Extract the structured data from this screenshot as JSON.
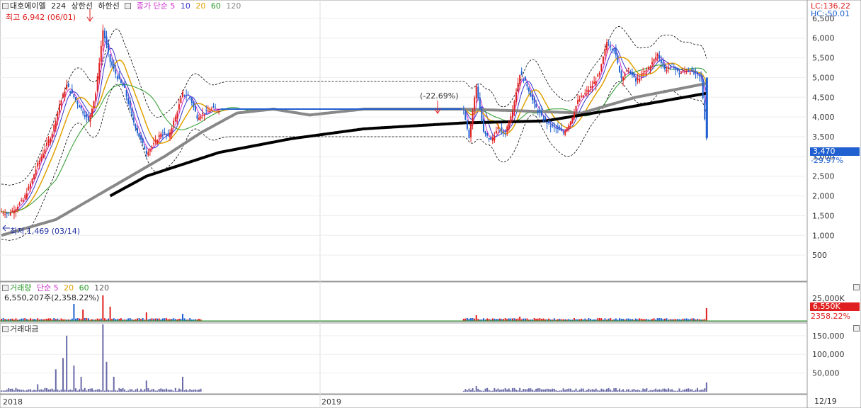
{
  "header": {
    "stock": "대호에이엘",
    "code": "224",
    "upper_band": "상한선",
    "lower_band": "하한선",
    "ma_label": "종가 단순 5",
    "ma10": "10",
    "ma20": "20",
    "ma60": "60",
    "ma120": "120"
  },
  "right_info": {
    "lc": "LC:136.22",
    "hc": "HC:-50.01",
    "current_price": "3,470",
    "change_pct": "-29.97%",
    "volume_badge": "6,550K",
    "volume_ratio": "2358.22%",
    "last_date": "12/19"
  },
  "annotations": {
    "high": "최고 6,942 (06/01)",
    "low": "최저 1,469 (03/14)",
    "drop": "(-22.69%)"
  },
  "volume_panel": {
    "title": "거래량",
    "ma_label": "단순 5",
    "ma20": "20",
    "ma60": "60",
    "ma120": "120",
    "current": "6,550,207주(2,358.22%)"
  },
  "amount_panel": {
    "title": "거래대금"
  },
  "colors": {
    "up": "#e02020",
    "down": "#2060d0",
    "ma5": "#cc33cc",
    "ma10": "#3333cc",
    "ma20": "#e0a000",
    "ma60": "#2a9a2a",
    "ma120": "#888888",
    "long_ma": "#000000",
    "amount": "#6a6aa8",
    "badge_price": "#2060d0",
    "badge_volume": "#e02020"
  },
  "chart_data": {
    "type": "candlestick",
    "x_labels": [
      "2018",
      "2019"
    ],
    "price_axis_ticks": [
      500,
      1000,
      1500,
      2000,
      2500,
      3000,
      3500,
      4000,
      4500,
      5000,
      5500,
      6000,
      6500
    ],
    "price_ylim": [
      0,
      7000
    ],
    "volume_axis_ticks": [
      "25,000K"
    ],
    "amount_axis_ticks": [
      "50,000",
      "100,000",
      "150,000"
    ],
    "amount_ylim": [
      0,
      180000
    ],
    "price_series": [
      {
        "i": 0,
        "c": 1600
      },
      {
        "i": 4,
        "c": 1550
      },
      {
        "i": 8,
        "c": 1700
      },
      {
        "i": 12,
        "c": 1900
      },
      {
        "i": 16,
        "c": 2300
      },
      {
        "i": 20,
        "c": 2800
      },
      {
        "i": 24,
        "c": 3200
      },
      {
        "i": 28,
        "c": 3600
      },
      {
        "i": 32,
        "c": 4300
      },
      {
        "i": 36,
        "c": 4800
      },
      {
        "i": 40,
        "c": 4500
      },
      {
        "i": 44,
        "c": 4200
      },
      {
        "i": 48,
        "c": 3900
      },
      {
        "i": 52,
        "c": 4600
      },
      {
        "i": 56,
        "c": 6200
      },
      {
        "i": 60,
        "c": 5400
      },
      {
        "i": 64,
        "c": 5000
      },
      {
        "i": 68,
        "c": 4700
      },
      {
        "i": 72,
        "c": 4000
      },
      {
        "i": 76,
        "c": 3500
      },
      {
        "i": 80,
        "c": 3100
      },
      {
        "i": 84,
        "c": 3300
      },
      {
        "i": 88,
        "c": 3600
      },
      {
        "i": 92,
        "c": 3500
      },
      {
        "i": 96,
        "c": 4000
      },
      {
        "i": 100,
        "c": 4600
      },
      {
        "i": 104,
        "c": 4500
      },
      {
        "i": 108,
        "c": 4000
      },
      {
        "i": 112,
        "c": 4100
      },
      {
        "i": 116,
        "c": 4200
      },
      {
        "i": 120,
        "c": 4200
      },
      {
        "i": 160,
        "c": 4200
      },
      {
        "i": 200,
        "c": 4200
      },
      {
        "i": 240,
        "c": 4200
      },
      {
        "i": 255,
        "c": 4200
      },
      {
        "i": 258,
        "c": 3500
      },
      {
        "i": 262,
        "c": 4800
      },
      {
        "i": 266,
        "c": 3600
      },
      {
        "i": 270,
        "c": 3400
      },
      {
        "i": 274,
        "c": 3700
      },
      {
        "i": 278,
        "c": 3600
      },
      {
        "i": 282,
        "c": 4200
      },
      {
        "i": 286,
        "c": 5100
      },
      {
        "i": 290,
        "c": 4800
      },
      {
        "i": 294,
        "c": 4300
      },
      {
        "i": 298,
        "c": 4000
      },
      {
        "i": 302,
        "c": 3800
      },
      {
        "i": 306,
        "c": 3700
      },
      {
        "i": 310,
        "c": 3600
      },
      {
        "i": 314,
        "c": 3900
      },
      {
        "i": 318,
        "c": 4400
      },
      {
        "i": 322,
        "c": 4600
      },
      {
        "i": 326,
        "c": 4800
      },
      {
        "i": 330,
        "c": 5100
      },
      {
        "i": 334,
        "c": 5900
      },
      {
        "i": 338,
        "c": 5700
      },
      {
        "i": 342,
        "c": 5000
      },
      {
        "i": 346,
        "c": 5200
      },
      {
        "i": 350,
        "c": 4900
      },
      {
        "i": 354,
        "c": 5100
      },
      {
        "i": 358,
        "c": 5300
      },
      {
        "i": 362,
        "c": 5600
      },
      {
        "i": 366,
        "c": 5200
      },
      {
        "i": 370,
        "c": 5300
      },
      {
        "i": 374,
        "c": 5100
      },
      {
        "i": 378,
        "c": 5200
      },
      {
        "i": 382,
        "c": 5100
      },
      {
        "i": 386,
        "c": 5000
      },
      {
        "i": 389,
        "c": 3470
      }
    ],
    "ma60_series": [
      {
        "i": 0,
        "c": 1000
      },
      {
        "i": 30,
        "c": 1400
      },
      {
        "i": 60,
        "c": 2200
      },
      {
        "i": 90,
        "c": 3000
      },
      {
        "i": 110,
        "c": 3600
      },
      {
        "i": 130,
        "c": 4100
      },
      {
        "i": 150,
        "c": 4200
      },
      {
        "i": 170,
        "c": 4050
      },
      {
        "i": 200,
        "c": 4200
      },
      {
        "i": 255,
        "c": 4200
      },
      {
        "i": 290,
        "c": 4150
      },
      {
        "i": 320,
        "c": 4100
      },
      {
        "i": 350,
        "c": 4500
      },
      {
        "i": 389,
        "c": 4850
      }
    ],
    "ma120_series": [
      {
        "i": 60,
        "c": 2000
      },
      {
        "i": 80,
        "c": 2500
      },
      {
        "i": 120,
        "c": 3100
      },
      {
        "i": 160,
        "c": 3450
      },
      {
        "i": 200,
        "c": 3700
      },
      {
        "i": 255,
        "c": 3850
      },
      {
        "i": 300,
        "c": 3900
      },
      {
        "i": 340,
        "c": 4200
      },
      {
        "i": 389,
        "c": 4600
      }
    ],
    "volume_spikes": [
      {
        "i": 40,
        "v": 0.6
      },
      {
        "i": 45,
        "v": 0.4
      },
      {
        "i": 56,
        "v": 0.9
      },
      {
        "i": 60,
        "v": 0.5
      },
      {
        "i": 80,
        "v": 0.3
      },
      {
        "i": 100,
        "v": 0.25
      },
      {
        "i": 262,
        "v": 0.2
      },
      {
        "i": 286,
        "v": 0.15
      },
      {
        "i": 389,
        "v": 0.45
      }
    ],
    "amount_spikes": [
      {
        "i": 20,
        "v": 20000
      },
      {
        "i": 30,
        "v": 60000
      },
      {
        "i": 34,
        "v": 90000
      },
      {
        "i": 36,
        "v": 150000
      },
      {
        "i": 40,
        "v": 70000
      },
      {
        "i": 44,
        "v": 40000
      },
      {
        "i": 56,
        "v": 180000
      },
      {
        "i": 58,
        "v": 80000
      },
      {
        "i": 62,
        "v": 40000
      },
      {
        "i": 80,
        "v": 30000
      },
      {
        "i": 100,
        "v": 40000
      },
      {
        "i": 110,
        "v": 8000
      },
      {
        "i": 262,
        "v": 15000
      },
      {
        "i": 286,
        "v": 10000
      },
      {
        "i": 389,
        "v": 25000
      }
    ]
  }
}
